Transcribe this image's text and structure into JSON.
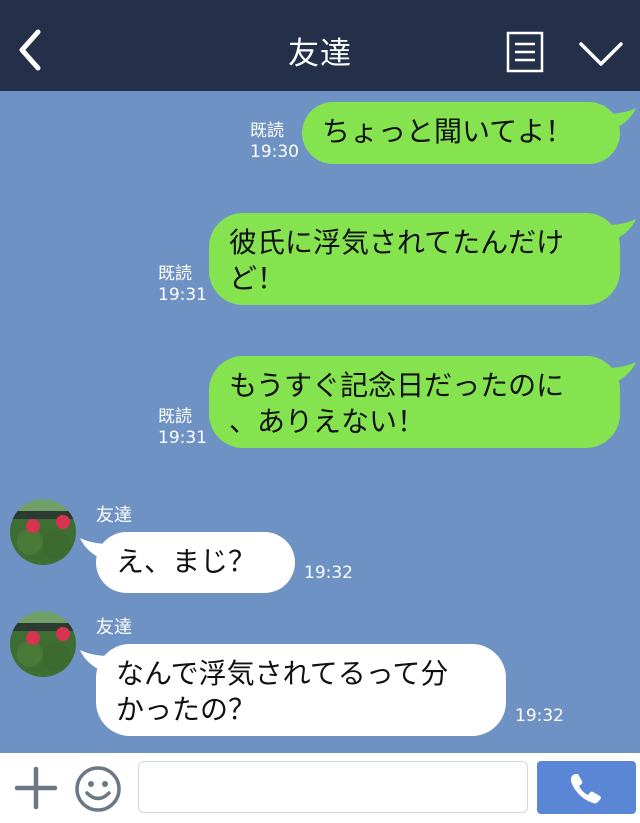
{
  "header": {
    "title": "友達",
    "back_icon": "chevron-left-icon",
    "notes_icon": "note-icon",
    "menu_icon": "chevron-down-icon"
  },
  "messages": [
    {
      "side": "sent",
      "text_lines": [
        "ちょっと聞いてよ！"
      ],
      "read": "既読",
      "time": "19:30"
    },
    {
      "side": "sent",
      "text_lines": [
        "彼氏に浮気されてたんだけ",
        "ど！"
      ],
      "read": "既読",
      "time": "19:31"
    },
    {
      "side": "sent",
      "text_lines": [
        "もうすぐ記念日だったのに",
        "、ありえない！"
      ],
      "read": "既読",
      "time": "19:31"
    },
    {
      "side": "received",
      "sender": "友達",
      "text_lines": [
        "え、まじ？"
      ],
      "time": "19:32"
    },
    {
      "side": "received",
      "sender": "友達",
      "text_lines": [
        "なんで浮気されてるって分",
        "かったの？"
      ],
      "time": "19:32"
    }
  ],
  "footer": {
    "plus_icon": "plus-icon",
    "emoji_icon": "smile-icon",
    "input_value": "",
    "call_icon": "phone-icon"
  },
  "colors": {
    "header_bg": "#242f49",
    "chat_bg": "#6f92c5",
    "sent_bubble": "#85e34f",
    "received_bubble": "#ffffff",
    "call_button": "#5a86d6"
  }
}
